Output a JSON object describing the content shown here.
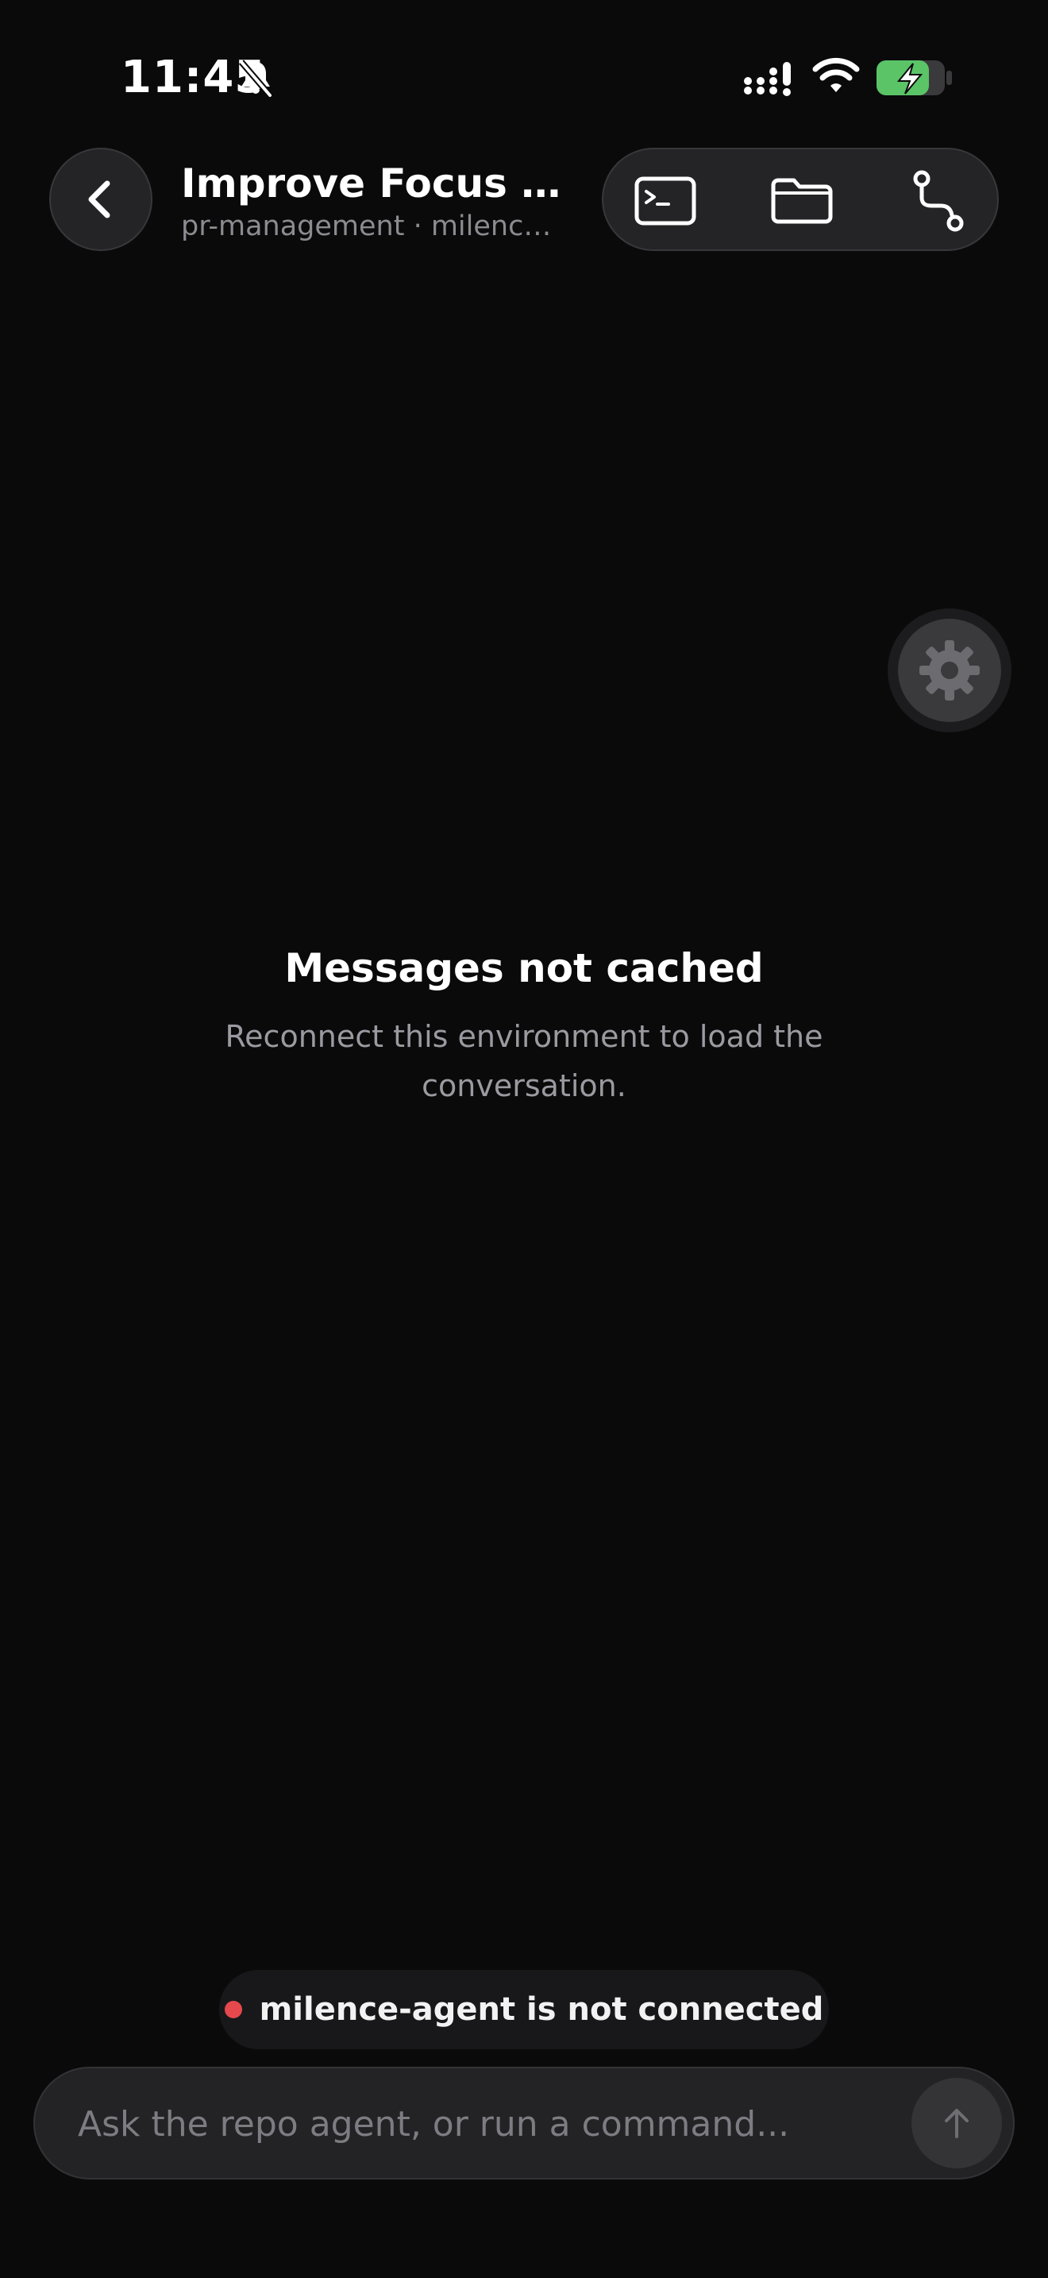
{
  "status_bar": {
    "time": "11:45",
    "icons": [
      "bell-slash-icon",
      "cellular-signal-icon",
      "wifi-icon",
      "battery-charging-icon"
    ],
    "battery_color": "#5ac467"
  },
  "header": {
    "back_icon": "chevron-left-icon",
    "title": "Improve Focus an...",
    "subtitle": "pr-management · milence-...",
    "tools": [
      "terminal-icon",
      "folder-icon",
      "branch-icon"
    ]
  },
  "settings": {
    "icon": "gear-icon"
  },
  "empty_state": {
    "title": "Messages not cached",
    "body": "Reconnect this environment to load the conversation."
  },
  "connection": {
    "status_color": "#e5484d",
    "text": "milence-agent is not connected"
  },
  "composer": {
    "placeholder": "Ask the repo agent, or run a command...",
    "value": "",
    "send_icon": "arrow-up-icon"
  },
  "colors": {
    "background": "#0a0a0b",
    "surface": "#242426"
  }
}
